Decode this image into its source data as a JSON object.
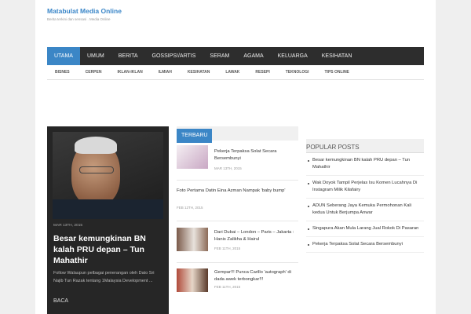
{
  "site": {
    "title": "Matabulat Media Online",
    "description": "Berita terkini dan sensasi . Media Online"
  },
  "main_nav": [
    "UTAMA",
    "UMUM",
    "BERITA",
    "GOSSIPS!/ARTIS",
    "SERAM",
    "AGAMA",
    "KELUARGA",
    "KESIHATAN"
  ],
  "sub_nav": [
    "BISNES",
    "CERPEN",
    "IKLAN-IKLAN",
    "ILMIAH",
    "KESIHATAN",
    "LAWAK",
    "RESEPI",
    "TEKNOLOGI",
    "TIPS ONLINE"
  ],
  "featured": {
    "date": "MAR 13TH, 2015",
    "title": "Besar kemungkinan BN kalah PRU depan – Tun Mahathir",
    "excerpt": "Follow Walaupun pelbagai penerangan oleh Dato Sri Najib Tun Razak tentang 1Malaysia Development ...",
    "read_more": "BACA"
  },
  "latest": {
    "tab_label": "TERBARU",
    "posts": [
      {
        "title": "Pekerja Terpaksa Solat Secara Bersembunyi",
        "date": "MAR 13TH, 2015"
      },
      {
        "title": "Foto Pertama Datin Eina Azman Nampak 'baby bump'",
        "date": "FEB 12TH, 2015"
      },
      {
        "title": "Dari Dubai – London – Paris – Jakarta : Hanis Zalikha & Hairul",
        "date": "FEB 11TH, 2015"
      },
      {
        "title": "Gempar!!! Punca Carillo 'autograph' di dada awek terbongkar!!!",
        "date": "FEB 11TH, 2015"
      }
    ]
  },
  "popular": {
    "heading": "POPULAR POSTS",
    "items": [
      "Besar kemungkinan BN kalah PRU depan – Tun Mahathir",
      "Wak Doyok Tampil Perjelas Isu Komen Lucahnya Di Instagram Milik Kilafairy",
      "ADUN Seberang Jaya Kemuka Permohonan Kali kedua Untuk Berjumpa Anwar",
      "Singapura Akan Mula Larang Jual Rokok Di Pasaran",
      "Pekerja Terpaksa Solat Secara Bersembunyi"
    ]
  }
}
